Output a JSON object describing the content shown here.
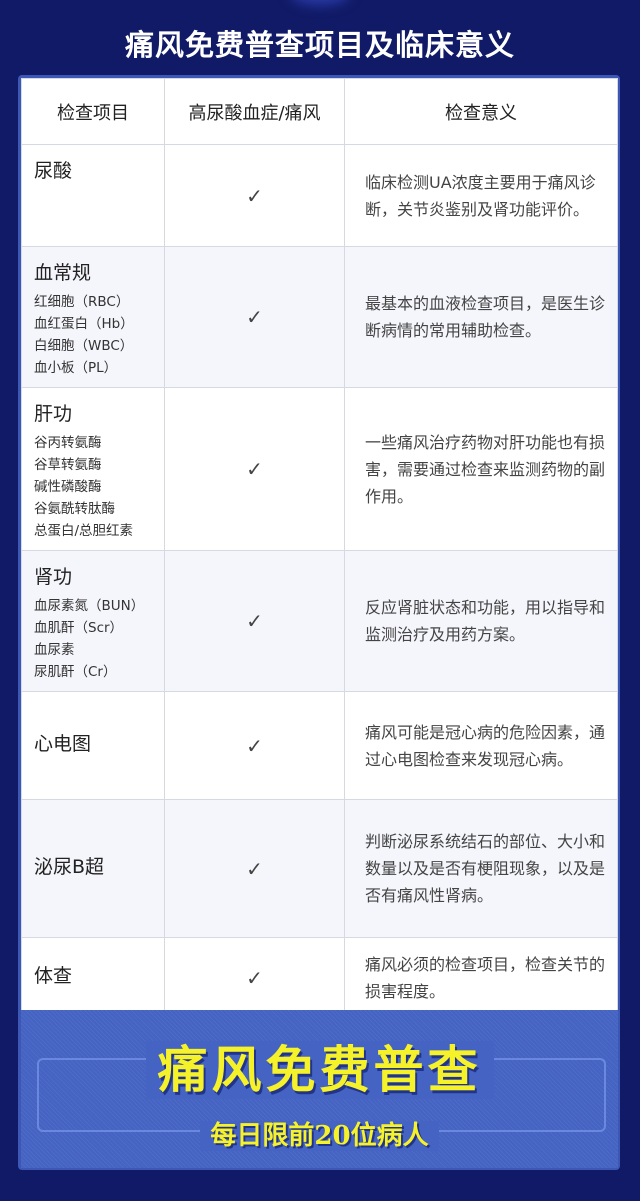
{
  "title": "痛风免费普查项目及临床意义",
  "table": {
    "headers": [
      "检查项目",
      "高尿酸血症/痛风",
      "检查意义"
    ],
    "rows": [
      {
        "item": "尿酸",
        "sub": "",
        "check": "✓",
        "meaning": "临床检测UA浓度主要用于痛风诊断，关节炎鉴别及肾功能评价。"
      },
      {
        "item": "血常规",
        "sub": "红细胞（RBC）\n血红蛋白（Hb）\n白细胞（WBC）\n血小板（PL）",
        "check": "✓",
        "meaning": "最基本的血液检查项目，是医生诊断病情的常用辅助检查。"
      },
      {
        "item": "肝功",
        "sub": "谷丙转氨酶\n谷草转氨酶\n碱性磷酸酶\n谷氨酰转肽酶\n总蛋白/总胆红素",
        "check": "✓",
        "meaning": "一些痛风治疗药物对肝功能也有损害，需要通过检查来监测药物的副作用。"
      },
      {
        "item": "肾功",
        "sub": "血尿素氮（BUN）\n血肌酐（Scr）\n血尿素\n尿肌酐（Cr）",
        "check": "✓",
        "meaning": "反应肾脏状态和功能，用以指导和监测治疗及用药方案。"
      },
      {
        "item": "心电图",
        "sub": "",
        "check": "✓",
        "meaning": "痛风可能是冠心病的危险因素，通过心电图检查来发现冠心病。"
      },
      {
        "item": "泌尿B超",
        "sub": "",
        "check": "✓",
        "meaning": "判断泌尿系统结石的部位、大小和数量以及是否有梗阻现象，以及是否有痛风性肾病。"
      },
      {
        "item": "体查",
        "sub": "",
        "check": "✓",
        "meaning": "痛风必须的检查项目，检查关节的损害程度。"
      }
    ]
  },
  "banner": {
    "title": "痛风免费普查",
    "subtitle": "每日限前20位病人"
  }
}
